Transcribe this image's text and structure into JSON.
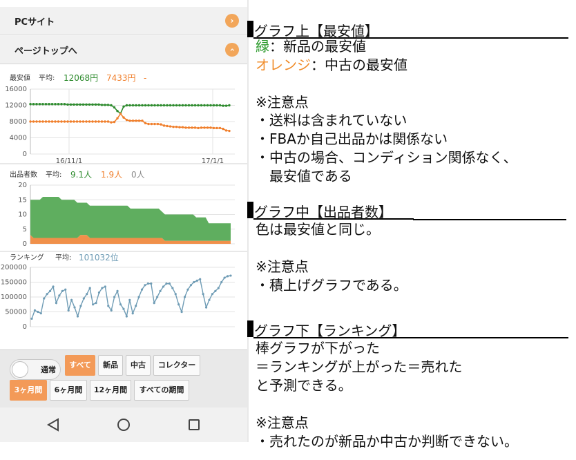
{
  "nav": {
    "pc_site": "PCサイト",
    "page_top": "ページトップへ",
    "chevron": "›"
  },
  "price_chart": {
    "title": "最安値",
    "avg_label": "平均:",
    "avg_new": "12068円",
    "avg_used": "7433円",
    "avg_collector": "-",
    "x_labels": [
      "16/11/1",
      "17/1/1"
    ],
    "y_ticks": [
      "16000",
      "12000",
      "8000",
      "4000",
      "0"
    ]
  },
  "sellers_chart": {
    "title": "出品者数",
    "avg_label": "平均:",
    "avg_new": "9.1人",
    "avg_used": "1.9人",
    "avg_collector": "0人",
    "y_ticks": [
      "20",
      "15",
      "10",
      "5",
      "0"
    ]
  },
  "rank_chart": {
    "title": "ランキング",
    "avg_label": "平均:",
    "avg_value": "101032位",
    "y_ticks": [
      "200000",
      "150000",
      "100000",
      "50000",
      "0"
    ]
  },
  "controls": {
    "toggle_label": "通常",
    "filters": [
      "すべて",
      "新品",
      "中古",
      "コレクター"
    ],
    "periods": [
      "3ヶ月間",
      "6ヶ月間",
      "12ヶ月間",
      "すべての期間"
    ]
  },
  "android_nav": [
    "back-icon",
    "home-icon",
    "recents-icon"
  ],
  "colors": {
    "new": "#2e8b2e",
    "used": "#f07f2c",
    "rank": "#6f9cb5",
    "accent": "#f39a58"
  },
  "notes": {
    "h1": "グラフ上【最安値】",
    "green_word": "緑",
    "green_rest": "：新品の最安値",
    "orange_word": "オレンジ",
    "orange_rest": "：中古の最安値",
    "caution1": "※注意点",
    "b1": "・送料は含まれていない",
    "b2": "・FBAか自己出品かは関係ない",
    "b3": "・中古の場合、コンディション関係なく、",
    "b3b": "　最安値である",
    "h2": "グラフ中【出品者数】",
    "c2": "色は最安値と同じ。",
    "caution2": "※注意点",
    "b4": "・積上げグラフである。",
    "h3": "グラフ下【ランキング】",
    "r1": "棒グラフが下がった",
    "r2": "＝ランキングが上がった＝売れた",
    "r3": "と予測できる。",
    "caution3": "※注意点",
    "b5": "・売れたのが新品か中古か判断できない。"
  },
  "chart_data": [
    {
      "type": "line",
      "title": "最安値",
      "x_tick_labels": [
        "16/11/1",
        "17/1/1"
      ],
      "ylim": [
        0,
        16000
      ],
      "y_ticks": [
        0,
        4000,
        8000,
        12000,
        16000
      ],
      "series": [
        {
          "name": "12068円",
          "color": "#2e8b2e",
          "values": [
            12300,
            12300,
            12300,
            12300,
            12300,
            12300,
            12300,
            12300,
            12300,
            12300,
            12300,
            12300,
            12200,
            12200,
            12200,
            12200,
            12200,
            12200,
            12200,
            12200,
            12200,
            12200,
            12200,
            12100,
            12100,
            12100,
            12000,
            11500,
            10600,
            10000,
            11700,
            12000,
            12000,
            12000,
            12000,
            12000,
            12000,
            12000,
            12000,
            12000,
            12000,
            12000,
            12000,
            12000,
            12000,
            12000,
            12000,
            12000,
            12000,
            12000,
            12000,
            12000,
            12000,
            12000,
            12000,
            12000,
            12000,
            12000,
            12000,
            12000,
            12000,
            12000,
            11900,
            11900,
            12000
          ]
        },
        {
          "name": "7433円",
          "color": "#f07f2c",
          "values": [
            8000,
            8000,
            8000,
            8000,
            8000,
            8000,
            8000,
            8000,
            8000,
            8000,
            8000,
            8000,
            8000,
            8000,
            8000,
            8000,
            8000,
            8000,
            8000,
            8000,
            8000,
            8000,
            8000,
            8000,
            8000,
            8000,
            7800,
            7900,
            8800,
            9900,
            9000,
            8400,
            8200,
            8200,
            8200,
            8200,
            8200,
            7600,
            7400,
            7400,
            7400,
            7400,
            7300,
            7000,
            6900,
            6800,
            6700,
            6700,
            6600,
            6600,
            6500,
            6500,
            6500,
            6500,
            6400,
            6500,
            6500,
            6500,
            6500,
            6400,
            6400,
            6400,
            6200,
            5800,
            5700
          ]
        }
      ]
    },
    {
      "type": "area",
      "title": "出品者数",
      "ylim": [
        0,
        20
      ],
      "y_ticks": [
        0,
        5,
        10,
        15,
        20
      ],
      "stacked": true,
      "series": [
        {
          "name": "1.9人",
          "color": "#f0904a",
          "values": [
            3,
            2,
            2,
            2,
            2,
            2,
            2,
            2,
            2,
            2,
            2,
            2,
            2,
            2,
            2,
            2,
            3,
            3,
            3,
            2,
            2,
            2,
            2,
            2,
            2,
            2,
            2,
            2,
            2,
            2,
            2,
            2,
            2,
            2,
            2,
            2,
            2,
            2,
            2,
            2,
            2,
            2,
            2,
            1,
            1,
            1,
            1,
            1,
            1,
            1,
            1,
            1,
            1,
            1,
            1,
            1,
            1,
            1,
            1,
            1,
            1,
            1,
            1,
            1,
            1
          ]
        },
        {
          "name": "9.1人",
          "color": "#5fae5f",
          "values": [
            12,
            13,
            13,
            13,
            14,
            14,
            14,
            14,
            14,
            14,
            13,
            13,
            13,
            13,
            13,
            12,
            11,
            11,
            11,
            11,
            11,
            11,
            11,
            11,
            11,
            11,
            11,
            11,
            11,
            11,
            11,
            11,
            10,
            10,
            10,
            10,
            10,
            10,
            10,
            10,
            10,
            10,
            9,
            9,
            9,
            9,
            9,
            9,
            9,
            9,
            9,
            9,
            9,
            8,
            8,
            8,
            8,
            6,
            6,
            6,
            6,
            6,
            6,
            6,
            6
          ]
        }
      ]
    },
    {
      "type": "line",
      "title": "ランキング",
      "ylim": [
        0,
        200000
      ],
      "y_ticks": [
        0,
        50000,
        100000,
        150000,
        200000
      ],
      "series": [
        {
          "name": "101032位",
          "color": "#6f9cb5",
          "values": [
            27000,
            55000,
            50000,
            45000,
            95000,
            110000,
            120000,
            135000,
            80000,
            105000,
            120000,
            125000,
            55000,
            90000,
            65000,
            35000,
            70000,
            95000,
            110000,
            130000,
            75000,
            80000,
            115000,
            130000,
            135000,
            70000,
            55000,
            100000,
            120000,
            75000,
            60000,
            35000,
            90000,
            45000,
            70000,
            100000,
            125000,
            140000,
            145000,
            145000,
            80000,
            100000,
            120000,
            135000,
            145000,
            145000,
            130000,
            110000,
            75000,
            50000,
            100000,
            125000,
            140000,
            150000,
            155000,
            160000,
            110000,
            65000,
            90000,
            110000,
            120000,
            130000,
            150000,
            165000,
            170000,
            172000
          ]
        }
      ]
    }
  ]
}
